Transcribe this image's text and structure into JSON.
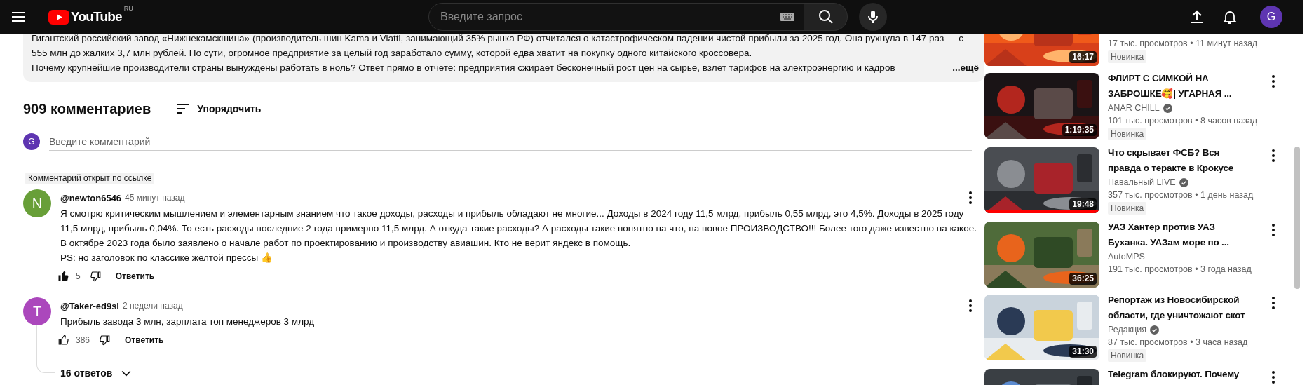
{
  "header": {
    "logo": {
      "text": "YouTube",
      "region": "RU"
    },
    "search": {
      "placeholder": "Введите запрос"
    },
    "account": {
      "initial": "G"
    }
  },
  "description": {
    "paragraphs": [
      "Гигантский российский завод «Нижнекамскшина» (производитель шин Kama и Viatti, занимающий 35% рынка РФ) отчитался о катастрофическом падении чистой прибыли за 2025 год. Она рухнула в 147 раз — с 555 млн до жалких 3,7 млн рублей. По сути, огромное предприятие за целый год заработало сумму, которой едва хватит на покупку одного китайского кроссовера."
    ],
    "last_line": "Почему крупнейшие производители страны вынуждены работать в ноль? Ответ прямо в отчете: предприятия сжирает бесконечный рост цен на сырье, взлет тарифов на электроэнергию и кадров",
    "more": "...ещё"
  },
  "comments": {
    "count_label": "909 комментариев",
    "sort_label": "Упорядочить",
    "input": {
      "avatar_initial": "G",
      "placeholder": "Введите комментарий"
    },
    "items": [
      {
        "pinned_label": "Комментарий открыт по ссылке",
        "avatar_initial": "N",
        "color": "#689f38",
        "author": "@newton6546",
        "time": "45 минут назад",
        "paragraphs": [
          "Я смотрю критическим мышлением и элементарным знанием что такое доходы, расходы и прибыль обладают не многие... Доходы в 2024 году 11,5 млрд, прибыль 0,55 млрд, это 4,5%. Доходы в 2025 году 11,5 млрд, прибыль 0,04%. То есть расходы последние 2 года примерно 11,5 млрд. А откуда такие расходы? А расходы такие понятно на что, на новое ПРОИЗВОДСТВО!!! Более того даже известно на какое. В октябре 2023 года было заявлено о начале работ по проектированию и производству авиашин. Кто не верит яндекс в помощь.",
          "PS: но заголовок по классике желтой прессы 👍"
        ],
        "likes": "5",
        "liked": true,
        "reply_label": "Ответить"
      },
      {
        "avatar_initial": "T",
        "color": "#ab47bc",
        "author": "@Taker-ed9si",
        "time": "2 недели назад",
        "paragraphs": [
          "Прибыль завода 3 млн, зарплата топ менеджеров 3 млрд"
        ],
        "likes": "386",
        "liked": false,
        "reply_label": "Ответить",
        "replies_label": "16 ответов"
      }
    ]
  },
  "related": [
    {
      "meta": "17 тыс. просмотров • 11 минут назад",
      "badge": "Новинка",
      "duration": "16:17"
    },
    {
      "title_lines": [
        "ФЛИРТ С СИМКОЙ НА",
        "ЗАБРОШКЕ🥰| УГАРНАЯ ..."
      ],
      "channel": "ANAR CHILL",
      "verified": true,
      "meta": "101 тыс. просмотров • 8 часов назад",
      "badge": "Новинка",
      "duration": "1:19:35"
    },
    {
      "title_lines": [
        "Что скрывает ФСБ? Вся",
        "правда о теракте в Крокусе"
      ],
      "channel": "Навальный LIVE",
      "verified": true,
      "meta": "357 тыс. просмотров • 1 день назад",
      "badge": "Новинка",
      "duration": "19:48",
      "progress": {
        "level": 1
      }
    },
    {
      "title_lines": [
        "УАЗ Хантер против УАЗ",
        "Буханка. УАЗам море по ..."
      ],
      "channel": "AutoMPS",
      "meta": "191 тыс. просмотров • 3 года назад",
      "duration": "36:25"
    },
    {
      "title_lines": [
        "Репортаж из Новосибирской",
        "области, где уничтожают скот"
      ],
      "channel": "Редакция",
      "verified": true,
      "meta": "87 тыс. просмотров • 3 часа назад",
      "badge": "Новинка",
      "duration": "31:30"
    },
    {
      "title_lines": [
        "Telegram блокируют. Почему"
      ]
    }
  ]
}
